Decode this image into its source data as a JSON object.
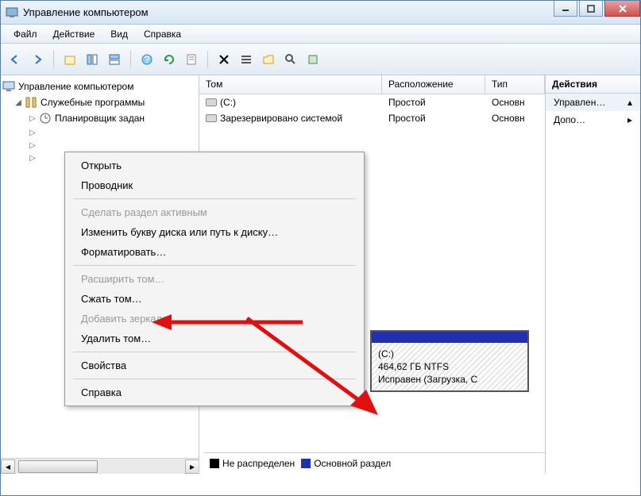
{
  "title": "Управление компьютером",
  "menu": {
    "file": "Файл",
    "action": "Действие",
    "view": "Вид",
    "help": "Справка"
  },
  "tree": {
    "root": "Управление компьютером",
    "utilities": "Служебные программы",
    "scheduler": "Планировщик задан"
  },
  "grid": {
    "headers": {
      "tom": "Том",
      "rasp": "Расположение",
      "tip": "Тип"
    },
    "rows": [
      {
        "tom": "(C:)",
        "rasp": "Простой",
        "tip": "Основн"
      },
      {
        "tom": "Зарезервировано системой",
        "rasp": "Простой",
        "tip": "Основн"
      }
    ]
  },
  "disk_panel": {
    "label": "(C:)",
    "size": "464,62 ГБ NTFS",
    "status": "Исправен (Загрузка, С"
  },
  "legend": {
    "unalloc": "Не распределен",
    "primary": "Основной раздел"
  },
  "actions": {
    "header": "Действия",
    "row1": "Управлен…",
    "row2": "Допо…"
  },
  "ctx": {
    "open": "Открыть",
    "explorer": "Проводник",
    "make_active": "Сделать раздел активным",
    "change_letter": "Изменить букву диска или путь к диску…",
    "format": "Форматировать…",
    "extend": "Расширить том…",
    "shrink": "Сжать том…",
    "add_mirror": "Добавить зеркало…",
    "delete": "Удалить том…",
    "properties": "Свойства",
    "help": "Справка"
  }
}
